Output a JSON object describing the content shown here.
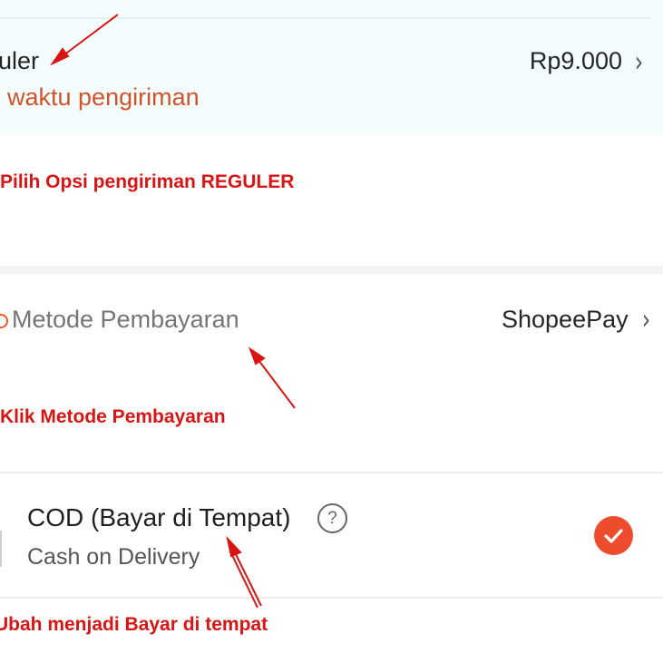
{
  "shipping": {
    "option_name": "uler",
    "eta_text": "waktu pengiriman",
    "price": "Rp9.000",
    "chevron_icon": "chevron-right-icon"
  },
  "payment": {
    "label": "Metode Pembayaran",
    "value": "ShopeePay",
    "chevron_icon": "chevron-right-icon"
  },
  "cod_option": {
    "title": "COD (Bayar di Tempat)",
    "subtitle": "Cash on Delivery",
    "help_glyph": "?",
    "help_icon": "question-circle-icon",
    "selected": true,
    "check_icon": "check-circle-icon"
  },
  "annotations": {
    "step1": "Pilih Opsi pengiriman REGULER",
    "step2": "Klik Metode Pembayaran",
    "step3": "Ubah menjadi Bayar di tempat"
  },
  "colors": {
    "accent": "#ee4d2d",
    "annotation": "#d81515",
    "shipping_eta": "#d0532c",
    "shipping_bg": "#f3fdfd"
  }
}
